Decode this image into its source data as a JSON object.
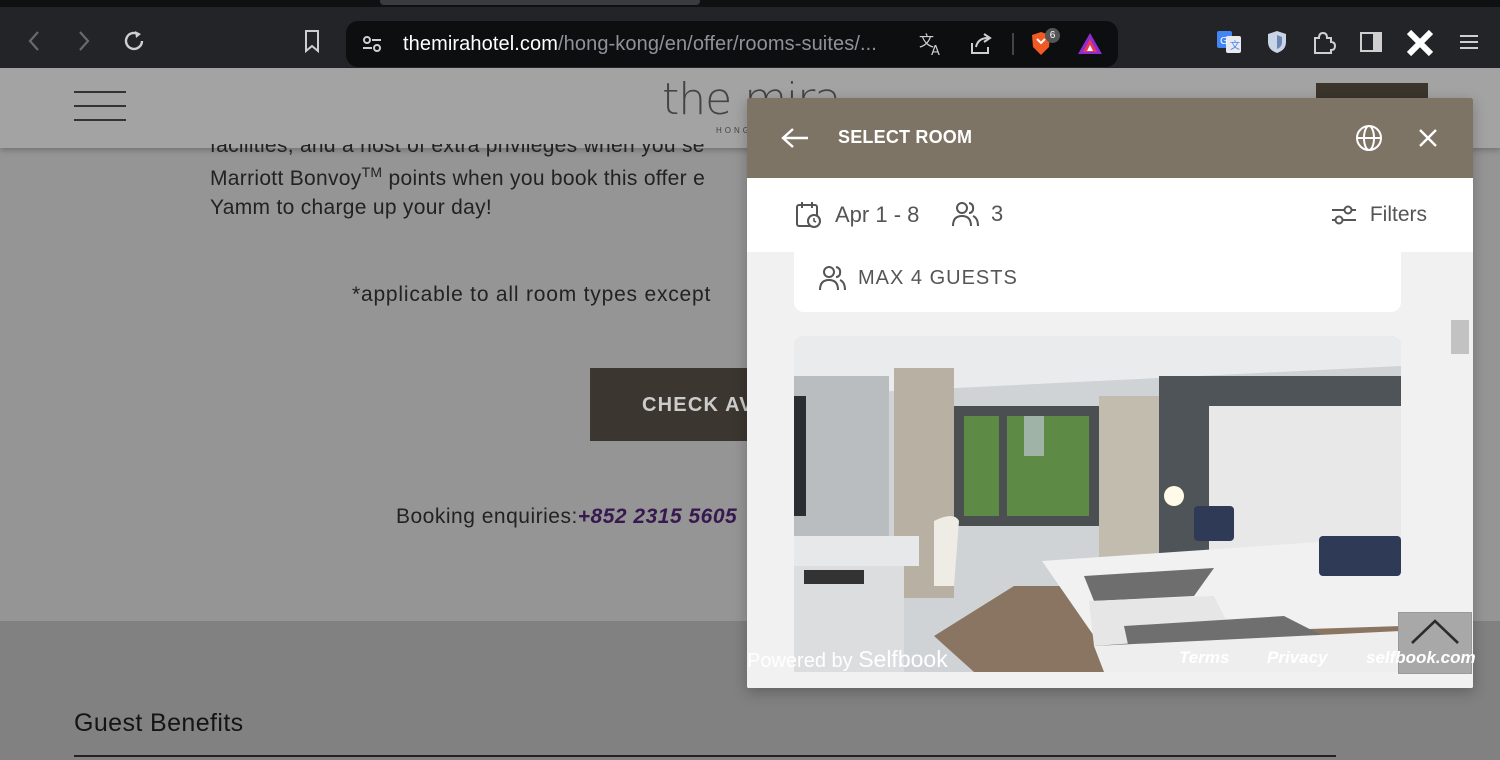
{
  "browser": {
    "url_domain": "themirahotel.com",
    "url_path": "/hong-kong/en/offer/rooms-suites/...",
    "shield_badge": "6"
  },
  "site": {
    "logo_text": "the mira",
    "logo_sub": "HONG",
    "paragraph_line1": "facilities, and a host of extra privileges when you se",
    "paragraph_line2a": "Marriott Bonvoy",
    "paragraph_line2_tm": "TM",
    "paragraph_line2b": " points when you book this offer e",
    "paragraph_line3": "Yamm to charge up your day!",
    "note": "*applicable to all room types except",
    "check_button": "CHECK AVAILABILITY",
    "enquiry_label": "Booking enquiries:",
    "enquiry_phone": "+852 2315 5605",
    "guest_benefits": "Guest Benefits"
  },
  "modal": {
    "title": "SELECT ROOM",
    "dates": "Apr 1 - 8",
    "guests": "3",
    "filters": "Filters",
    "max_guests": "MAX 4 GUESTS"
  },
  "footer": {
    "powered_by": "Powered by",
    "brand": "Selfbook",
    "terms": "Terms",
    "privacy": "Privacy",
    "selfbook_link": "selfbook.com"
  },
  "colors": {
    "modal_header": "#7d7466",
    "page_dim": "#959595",
    "button": "#3c3630"
  }
}
